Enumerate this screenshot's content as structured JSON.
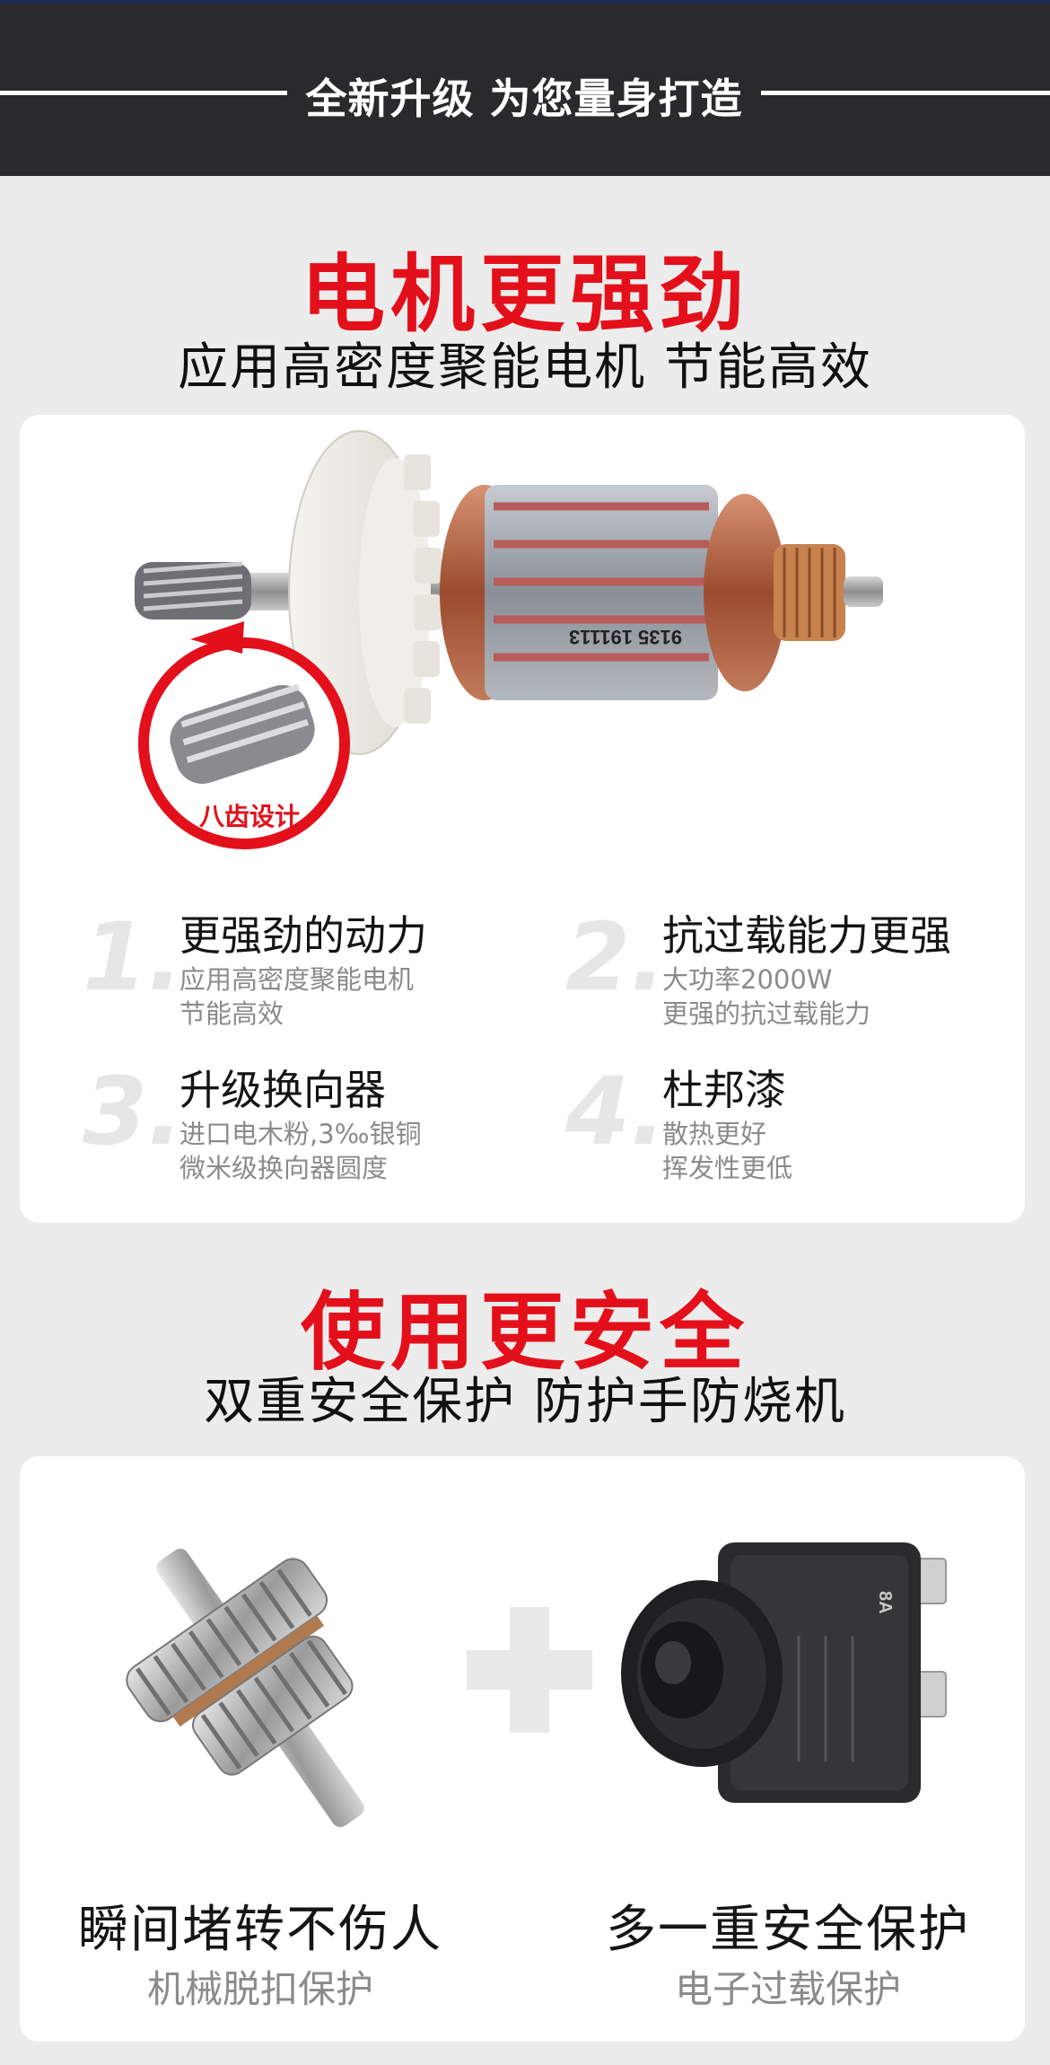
{
  "banner": {
    "title": "全新升级 为您量身打造"
  },
  "motor_section": {
    "heading": "电机更强劲",
    "subheading": "应用高密度聚能电机 节能高效",
    "armature_label": "9135 191113",
    "badge": "八齿设计",
    "features": [
      {
        "num": "1.",
        "title": "更强劲的动力",
        "desc_1": "应用高密度聚能电机",
        "desc_2": "节能高效"
      },
      {
        "num": "2.",
        "title": "抗过载能力更强",
        "desc_1": "大功率2000W",
        "desc_2": "更强的抗过载能力"
      },
      {
        "num": "3.",
        "title": "升级换向器",
        "desc_1": "进口电木粉,3‰银铜",
        "desc_2": "微米级换向器圆度"
      },
      {
        "num": "4.",
        "title": "杜邦漆",
        "desc_1": "散热更好",
        "desc_2": "挥发性更低"
      }
    ]
  },
  "safety_section": {
    "heading": "使用更安全",
    "subheading": "双重安全保护 防护手防烧机",
    "left": {
      "title": "瞬间堵转不伤人",
      "sub": "机械脱扣保护"
    },
    "right": {
      "title": "多一重安全保护",
      "sub": "电子过载保护",
      "breaker_label": "8A"
    }
  },
  "colors": {
    "accent_red": "#e3101b",
    "banner_bg": "#2a2a2c",
    "page_bg": "#ececec"
  }
}
